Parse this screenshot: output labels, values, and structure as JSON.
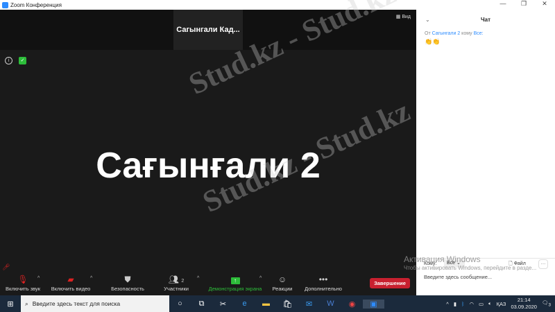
{
  "window": {
    "title": "Zoom Конференция",
    "minimize": "—",
    "maximize": "❐",
    "close": "✕"
  },
  "video": {
    "thumbnail_name": "Сагынгали  Кад...",
    "view_label": "Вид",
    "speaker_name": "Сағынғали 2"
  },
  "toolbar": {
    "unmute": "Включить звук",
    "start_video": "Включить видео",
    "security": "Безопасность",
    "participants": "Участники",
    "participants_count": "2",
    "share": "Демонстрация экрана",
    "reactions": "Реакции",
    "more": "Дополнительно",
    "end": "Завершение"
  },
  "chat": {
    "title": "Чат",
    "from": "От",
    "sender": "Сагынгали 2",
    "to": "кому",
    "recipient": "Все:",
    "message": "👏👏",
    "to_label": "Кому:",
    "to_value": "Все",
    "file": "Файл",
    "input_placeholder": "Введите здесь сообщение..."
  },
  "activation": {
    "title": "Активация Windows",
    "text": "Чтобы активировать Windows, перейдите в разде..."
  },
  "taskbar": {
    "search_placeholder": "Введите здесь текст для поиска",
    "lang": "ҚАЗ",
    "time": "21:14",
    "date": "03.09.2020",
    "notifications": "3"
  },
  "watermark": "Stud.kz - Stud.kz"
}
